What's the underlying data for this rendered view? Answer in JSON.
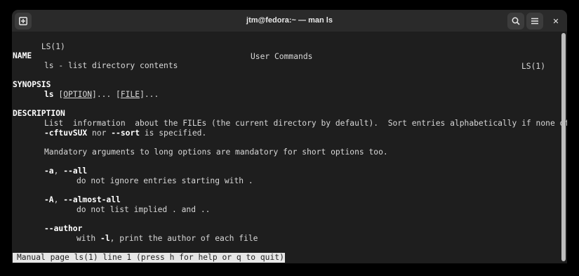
{
  "window": {
    "title": "jtm@fedora:~ — man ls"
  },
  "icons": {
    "new_tab": "new-tab-icon",
    "search": "search-icon",
    "menu": "hamburger-menu-icon",
    "close": "close-icon",
    "close_glyph": "✕"
  },
  "man": {
    "header_left": "LS(1)",
    "header_center": "User Commands",
    "header_right": "LS(1)",
    "name_heading": "NAME",
    "name_text": "ls - list directory contents",
    "synopsis_heading": "SYNOPSIS",
    "synopsis_cmd": "ls",
    "synopsis_sp1": " ",
    "synopsis_option": "OPTION",
    "synopsis_mid": "]... [",
    "synopsis_file": "FILE",
    "synopsis_end": "]...",
    "synopsis_open": "[",
    "description_heading": "DESCRIPTION",
    "desc_line1": "List  information  about the FILEs (the current directory by default).  Sort entries alphabetically if none of",
    "desc_line2_opt1": "-cftuvSUX",
    "desc_line2_mid": " nor ",
    "desc_line2_opt2": "--sort",
    "desc_line2_end": " is specified.",
    "mandatory": "Mandatory arguments to long options are mandatory for short options too.",
    "opt_a_short": "-a",
    "opt_a_sep": ", ",
    "opt_a_long": "--all",
    "opt_a_desc": "do not ignore entries starting with .",
    "opt_A_short": "-A",
    "opt_A_sep": ", ",
    "opt_A_long": "--almost-all",
    "opt_A_desc": "do not list implied . and ..",
    "opt_author": "--author",
    "opt_author_pre": "with ",
    "opt_author_flag": "-l",
    "opt_author_post": ", print the author of each file"
  },
  "status_line": "Manual page ls(1) line 1 (press h for help or q to quit)"
}
